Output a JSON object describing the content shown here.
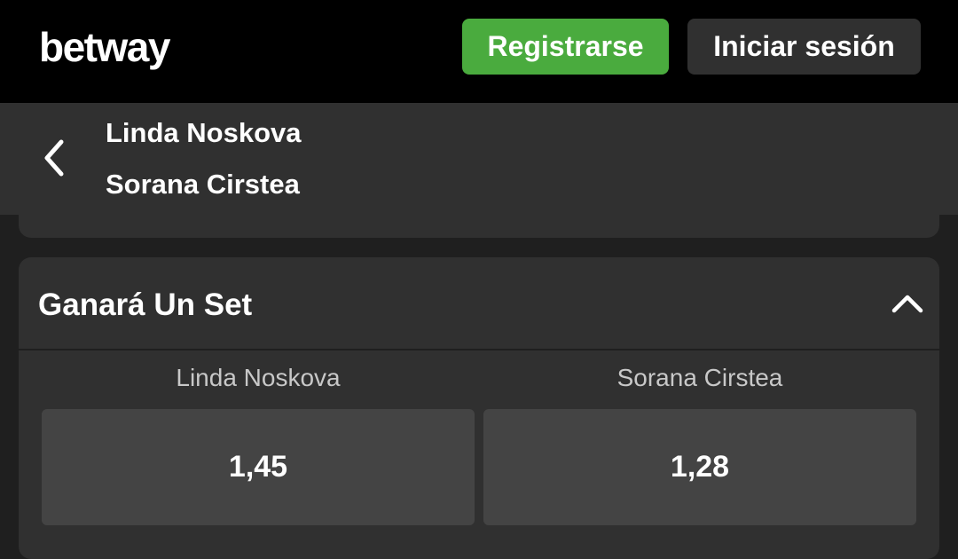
{
  "header": {
    "logo": "betway",
    "register_label": "Registrarse",
    "login_label": "Iniciar sesión"
  },
  "event": {
    "team_home": "Linda Noskova",
    "team_away": "Sorana Cirstea"
  },
  "market": {
    "title": "Ganará Un Set",
    "expanded": true,
    "selections": [
      {
        "name": "Linda Noskova",
        "odds": "1,45"
      },
      {
        "name": "Sorana Cirstea",
        "odds": "1,28"
      }
    ]
  },
  "colors": {
    "register_bg": "#4aab3e",
    "header_bg": "#000000",
    "card_bg": "#303030",
    "odds_bg": "#444444"
  },
  "icons": {
    "back": "chevron-left-icon",
    "collapse": "chevron-up-icon"
  }
}
